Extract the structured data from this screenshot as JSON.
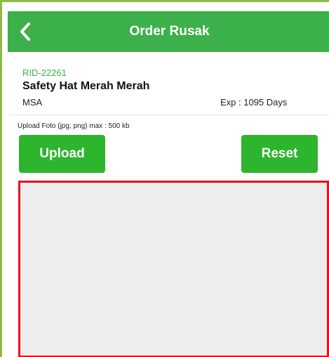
{
  "header": {
    "title": "Order Rusak",
    "back_icon": "chevron-left-icon"
  },
  "item": {
    "id": "RID-22261",
    "name": "Safety Hat Merah Merah",
    "brand": "MSA",
    "expiry": "Exp : 1095 Days"
  },
  "upload": {
    "hint": "Upload Foto (jpg, png) max : 500 kb",
    "upload_label": "Upload",
    "reset_label": "Reset"
  },
  "colors": {
    "header_bg": "#3cb04a",
    "button_bg": "#2db52d",
    "rid_text": "#3cb04a",
    "preview_border": "#e8111b",
    "preview_bg": "#ededed",
    "frame_border": "#8dbb4a"
  }
}
